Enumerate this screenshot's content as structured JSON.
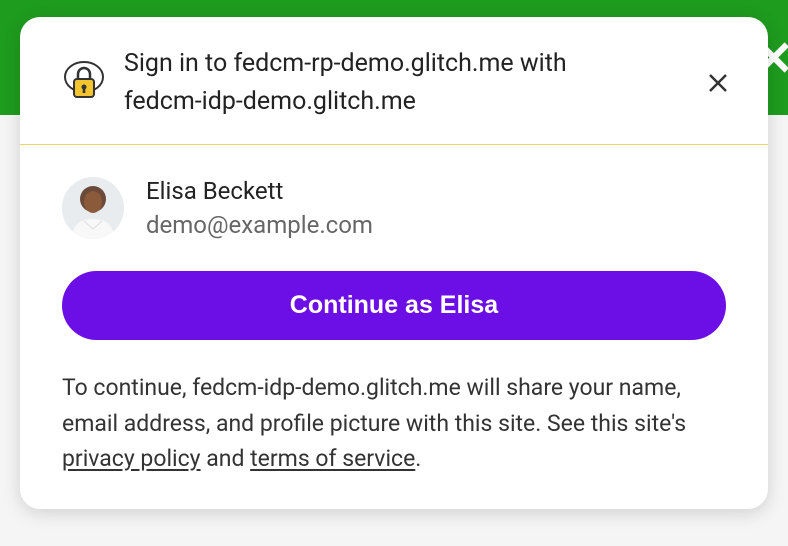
{
  "header": {
    "title_line1": "Sign in to fedcm-rp-demo.glitch.me with",
    "title_line2": "fedcm-idp-demo.glitch.me"
  },
  "account": {
    "name": "Elisa Beckett",
    "email": "demo@example.com"
  },
  "continue_label": "Continue as Elisa",
  "disclosure": {
    "text_before": "To continue, fedcm-idp-demo.glitch.me will share your name, email address, and profile picture with this site. See this site's ",
    "privacy_link": "privacy policy",
    "between": " and ",
    "terms_link": "terms of service",
    "after": "."
  },
  "icons": {
    "lock": "lock-icon",
    "close": "close-icon"
  },
  "colors": {
    "accent": "#6b0fe6",
    "topbar": "#1e9c1e"
  }
}
